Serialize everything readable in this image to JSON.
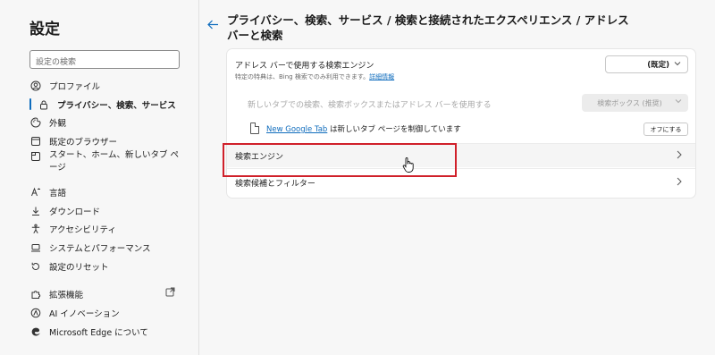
{
  "sidebar": {
    "title": "設定",
    "search_placeholder": "設定の検索",
    "items": [
      {
        "icon": "profile-icon",
        "label": "プロファイル"
      },
      {
        "icon": "lock-icon",
        "label": "プライバシー、検索、サービス"
      },
      {
        "icon": "appearance-icon",
        "label": "外観"
      },
      {
        "icon": "browser-icon",
        "label": "既定のブラウザー"
      },
      {
        "icon": "tab-icon",
        "label": "スタート、ホーム、新しいタブ ページ"
      },
      {
        "icon": "language-icon",
        "label": "言語"
      },
      {
        "icon": "download-icon",
        "label": "ダウンロード"
      },
      {
        "icon": "accessibility-icon",
        "label": "アクセシビリティ"
      },
      {
        "icon": "laptop-icon",
        "label": "システムとパフォーマンス"
      },
      {
        "icon": "reset-icon",
        "label": "設定のリセット"
      },
      {
        "icon": "extensions-icon",
        "label": "拡張機能"
      },
      {
        "icon": "ai-icon",
        "label": "AI イノベーション"
      },
      {
        "icon": "edge-logo-icon",
        "label": "Microsoft Edge について"
      }
    ]
  },
  "main": {
    "title": "プライバシー、検索、サービス / 検索と接続されたエクスペリエンス / アドレス バーと検索",
    "address_bar_engine": {
      "label": "アドレス バーで使用する検索エンジン",
      "sub": "特定の特典は、Bing 検索でのみ利用できます。",
      "sub_link": "詳細情報",
      "value": "(既定)"
    },
    "new_tab_search": {
      "label": "新しいタブでの検索、検索ボックスまたはアドレス バーを使用する",
      "value": "検索ボックス (推奨)"
    },
    "new_tab_control": {
      "link": "New Google Tab",
      "text": " は新しいタブ ページを制御しています",
      "button": "オフにする"
    },
    "rows": [
      {
        "label": "検索エンジン"
      },
      {
        "label": "検索候補とフィルター"
      }
    ]
  },
  "colors": {
    "accent": "#0f6cbd",
    "highlight": "#d0202a"
  }
}
